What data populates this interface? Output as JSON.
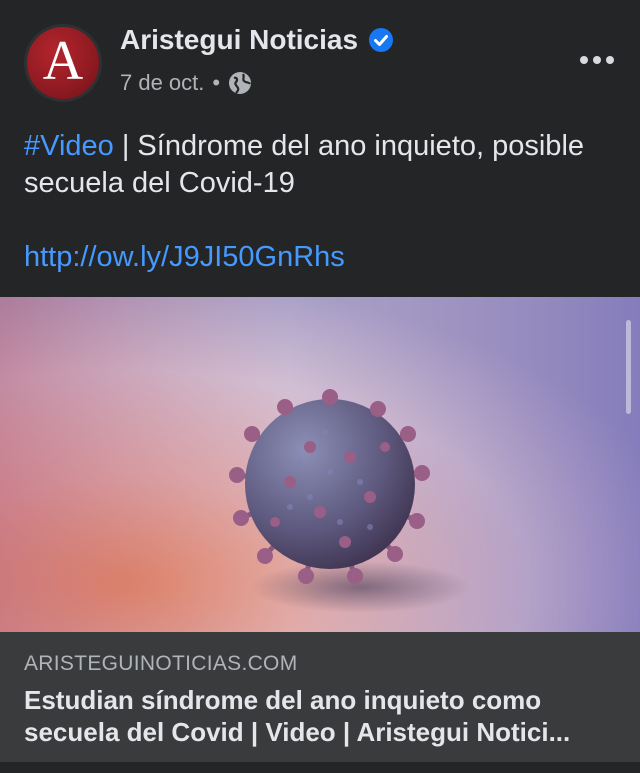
{
  "post": {
    "page_name": "Aristegui Noticias",
    "avatar_letter": "A",
    "date": "7 de oct.",
    "separator": "•",
    "hashtag": "#Video",
    "text": " | Síndrome del ano inquieto, posible secuela del Covid-19",
    "link": "http://ow.ly/J9JI50GnRhs",
    "icons": {
      "verified": "verified-badge-icon",
      "privacy": "globe-icon",
      "more": "more-options-icon"
    },
    "colors": {
      "link": "#4599ff",
      "verified": "#1877f2",
      "avatar": "#a81f28"
    }
  },
  "link_preview": {
    "domain": "ARISTEGUINOTICIAS.COM",
    "title_line1": "Estudian síndrome del ano inquieto como",
    "title_line2": "secuela del Covid | Video | Aristegui Notici..."
  }
}
